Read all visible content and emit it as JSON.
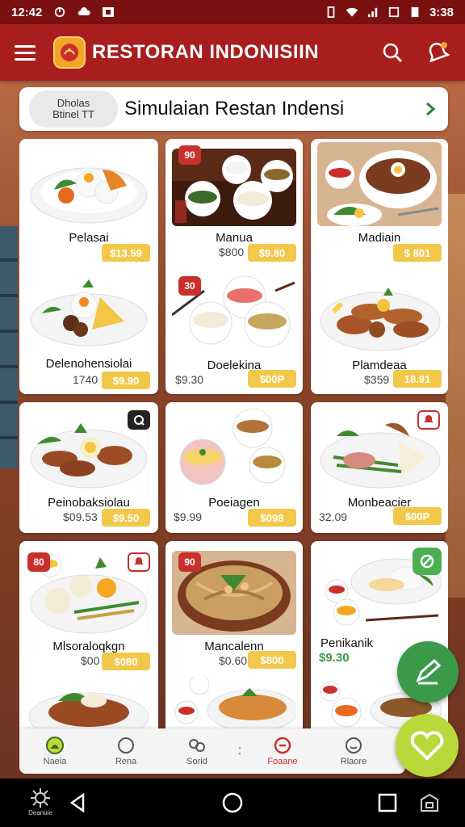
{
  "status_bar": {
    "time_left": "12:42",
    "time_right": "3:38"
  },
  "app_bar": {
    "title": "RESTORAN INDONISIIN",
    "menu_icon": "hamburger-menu-icon",
    "search_icon": "search-icon",
    "notification_icon": "notification-bell-icon",
    "brand_color": "#a81d1d"
  },
  "banner": {
    "chip_text": "Dholas\nBtinel TT",
    "title": "Simulaian Restan Indensi",
    "chevron_icon": "chevron-right-icon"
  },
  "menu_items": [
    {
      "name": "Pelasai",
      "sub": "",
      "price": "$13.59",
      "tag": ""
    },
    {
      "name": "Manua",
      "sub": "$800",
      "price": "$9.80",
      "tag": "90"
    },
    {
      "name": "Madiain",
      "sub": "",
      "price": "$ 801",
      "tag": ""
    },
    {
      "name": "Delenohensiolai",
      "sub": "1740",
      "price": "$9.90",
      "tag": ""
    },
    {
      "name": "Doelekina",
      "sub": "$9.30",
      "price": "$00P",
      "tag": "30"
    },
    {
      "name": "Plamdeaa",
      "sub": "$359",
      "price": "18.91",
      "tag": ""
    },
    {
      "name": "Peinobaksiolau",
      "sub": "$09.53",
      "price": "$9.50",
      "tag": ""
    },
    {
      "name": "Poeiagen",
      "sub": "$9.99",
      "price": "$098",
      "tag": ""
    },
    {
      "name": "Monbeacier",
      "sub": "32.09",
      "price": "$00P",
      "tag": ""
    },
    {
      "name": "Mlsoraloqkgn",
      "sub": "$00",
      "price": "$080",
      "tag": "80"
    },
    {
      "name": "Mancalenn",
      "sub": "$0.60",
      "price": "$800",
      "tag": "90"
    },
    {
      "name": "Penikanik",
      "sub": "$9.30",
      "price": "",
      "tag": ""
    }
  ],
  "bottom_nav": [
    {
      "label": "Naeia",
      "icon": "home-icon"
    },
    {
      "label": "Rena",
      "icon": "circle-icon"
    },
    {
      "label": "Sorid",
      "icon": "share-icon"
    },
    {
      "label": "Foaane",
      "icon": "favorite-icon"
    },
    {
      "label": "Rlaore",
      "icon": "chat-icon"
    }
  ],
  "fab": {
    "edit_icon": "edit-pencil-icon",
    "heart_icon": "heart-icon"
  },
  "system_nav": {
    "left_label": "Deanuie"
  }
}
